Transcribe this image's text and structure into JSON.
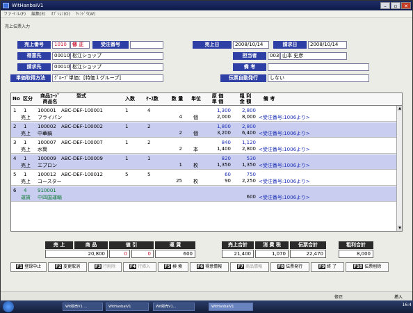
{
  "window": {
    "title": "WitHanbaiV1",
    "menu": [
      "ファイル(F)",
      "編集(E)",
      "ｵﾌﾟｼｮﾝ(O)",
      "ｳｨﾝﾄﾞｳ(W)"
    ],
    "form_title": "売上伝票入力"
  },
  "header": {
    "sales_no_label": "売上番号",
    "sales_no": "1010",
    "mode": "修 正",
    "order_no_label": "受注番号",
    "order_no": "",
    "sales_date_label": "売上日",
    "sales_date": "2008/10/14",
    "billing_date_label": "請求日",
    "billing_date": "2008/10/14",
    "customer_label": "得意先",
    "customer_code": "00010",
    "customer_name": "松江ショップ",
    "staff_label": "担当者",
    "staff_code": "003",
    "staff_name": "山本 史彦",
    "bill_to_label": "請求先",
    "bill_to_code": "00010",
    "bill_to_name": "松江ショップ",
    "remarks_label": "備 考",
    "remarks": "",
    "price_method_label": "単価取得方法",
    "price_method": "ｸﾞﾙｰﾌﾟ単価：[特価１グループ]",
    "auto_issue_label": "伝票自動発行",
    "auto_issue": "しない"
  },
  "grid": {
    "headers": {
      "no": "No",
      "kubun": "区分",
      "code": "商品ｺｰﾄﾞ",
      "name": "商品名",
      "model": "型式",
      "irisu": "入数",
      "cases": "ｹｰｽ数",
      "qty": "数 量",
      "unit": "単位",
      "cost": "原 価",
      "price": "単 価",
      "profit": "粗 利",
      "amount": "金 額",
      "note": "備 考"
    },
    "rows": [
      {
        "no": "1",
        "k1": "1",
        "k2": "売上",
        "code": "100001",
        "model": "ABC-DEF-100001",
        "name": "フライパン",
        "irisu": "1",
        "cases": "4",
        "qty": "4",
        "unit": "個",
        "cost": "1,300",
        "price": "2,000",
        "profit": "2,800",
        "amount": "8,000",
        "note": "<受注番号:1006より>"
      },
      {
        "no": "2",
        "k1": "1",
        "k2": "売上",
        "code": "100002",
        "model": "ABC-DEF-100002",
        "name": "中華鍋",
        "irisu": "1",
        "cases": "2",
        "qty": "2",
        "unit": "個",
        "cost": "1,800",
        "price": "3,200",
        "profit": "2,800",
        "amount": "6,400",
        "note": "<受注番号:1006より>"
      },
      {
        "no": "3",
        "k1": "1",
        "k2": "売上",
        "code": "100007",
        "model": "ABC-DEF-100007",
        "name": "水筒",
        "irisu": "1",
        "cases": "2",
        "qty": "2",
        "unit": "本",
        "cost": "840",
        "price": "1,400",
        "profit": "1,120",
        "amount": "2,800",
        "note": "<受注番号:1006より>"
      },
      {
        "no": "4",
        "k1": "1",
        "k2": "売上",
        "code": "100009",
        "model": "ABC-DEF-100009",
        "name": "エプロン",
        "irisu": "1",
        "cases": "1",
        "qty": "1",
        "unit": "枚",
        "cost": "820",
        "price": "1,350",
        "profit": "530",
        "amount": "1,350",
        "note": "<受注番号:1006より>"
      },
      {
        "no": "5",
        "k1": "1",
        "k2": "売上",
        "code": "100012",
        "model": "ABC-DEF-100012",
        "name": "コースター",
        "irisu": "5",
        "cases": "5",
        "qty": "25",
        "unit": "枚",
        "cost": "60",
        "price": "90",
        "profit": "750",
        "amount": "2,250",
        "note": "<受注番号:1006より>"
      },
      {
        "no": "6",
        "k1": "4",
        "k2": "運賃",
        "code": "910001",
        "model": "",
        "name": "中四国運輸",
        "irisu": "",
        "cases": "",
        "qty": "",
        "unit": "",
        "cost": "",
        "price": "",
        "profit": "",
        "amount": "600",
        "note": "<受注番号:1006より>"
      }
    ]
  },
  "totals": {
    "sales_label": "売 上",
    "goods_label": "商 品",
    "discount_label": "値 引",
    "freight_label": "運 賃",
    "sales_total_label": "売上合計",
    "tax_label": "消 費 税",
    "slip_total_label": "伝票合計",
    "profit_total_label": "粗利合計",
    "goods": "20,800",
    "goods2": "0",
    "discount": "0",
    "freight": "600",
    "sales_total": "21,400",
    "tax": "1,070",
    "slip_total": "22,470",
    "profit_total": "8,000"
  },
  "fkeys": [
    {
      "key": "F1",
      "label": "登録中止",
      "enabled": true
    },
    {
      "key": "F2",
      "label": "変更取消",
      "enabled": true
    },
    {
      "key": "F3",
      "label": "行削除",
      "enabled": false
    },
    {
      "key": "F4",
      "label": "行挿入",
      "enabled": false
    },
    {
      "key": "F5",
      "label": "検 索",
      "enabled": true
    },
    {
      "key": "F6",
      "label": "得意情報",
      "enabled": true
    },
    {
      "key": "F7",
      "label": "商品情報",
      "enabled": false
    },
    {
      "key": "F8",
      "label": "伝票発行",
      "enabled": true
    },
    {
      "key": "F9",
      "label": "終 了",
      "enabled": true
    },
    {
      "key": "F10",
      "label": "伝票削除",
      "enabled": true
    }
  ],
  "status": {
    "mode": "修正",
    "ins": "挿入"
  },
  "taskbar": {
    "items": [
      "Wit販売V1 ...",
      "WitHanbaiV1",
      "Wit販売V1...",
      "WitHanbaiV1"
    ],
    "clock": "16:4"
  }
}
